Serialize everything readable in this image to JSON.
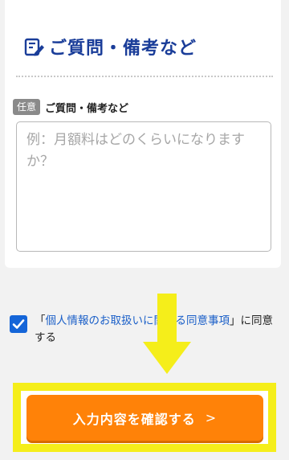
{
  "section": {
    "title": "ご質問・備考など",
    "icon": "memo-pen-icon"
  },
  "field": {
    "badge": "任意",
    "label": "ご質問・備考など",
    "placeholder": "例：月額料はどのくらいになりますか？",
    "value": ""
  },
  "consent": {
    "checked": true,
    "prefix": "「",
    "link_text": "個人情報のお取扱いに関する同意事項",
    "suffix": "」に同意する"
  },
  "submit": {
    "label": "入力内容を確認する",
    "chevron": ">"
  },
  "colors": {
    "title": "#1a3d99",
    "button": "#ff8208",
    "highlight": "#f5ee1a",
    "checkbox": "#1565d8",
    "link": "#1a5fc8"
  }
}
